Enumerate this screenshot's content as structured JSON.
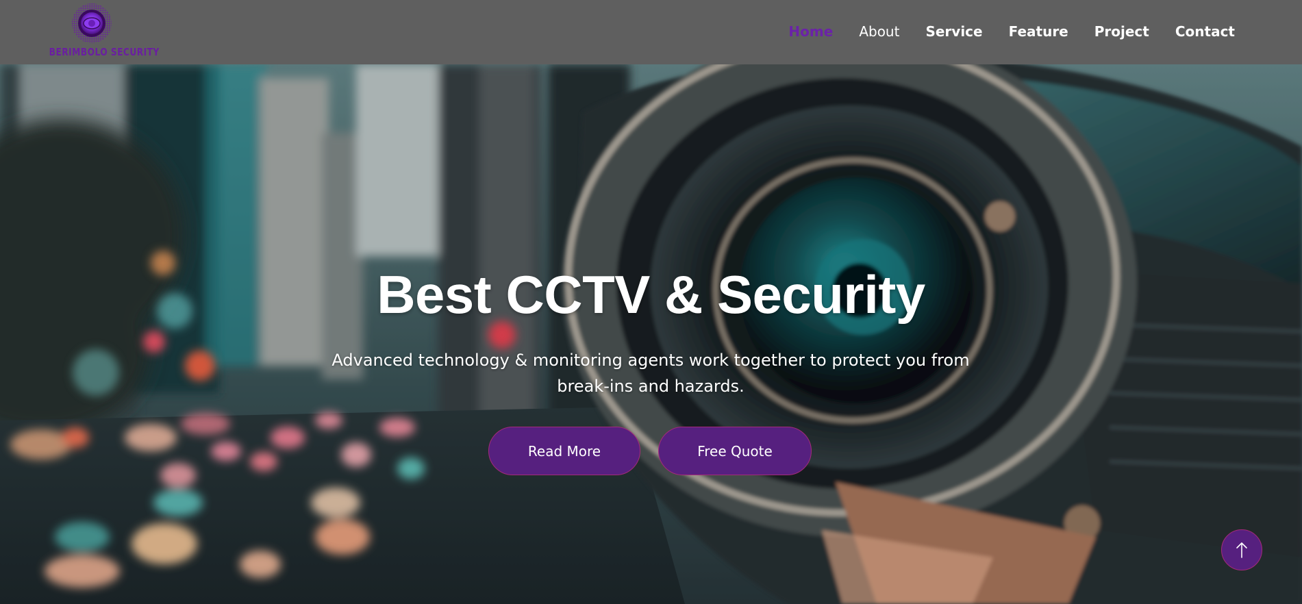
{
  "brand": {
    "name": "BERIMBOLO SECURITY",
    "color": "#6a1fa0",
    "logo_icon": "eye-lens-icon"
  },
  "nav": {
    "items": [
      {
        "label": "Home",
        "active": true
      },
      {
        "label": "About",
        "active": false
      },
      {
        "label": "Service",
        "active": false
      },
      {
        "label": "Feature",
        "active": false
      },
      {
        "label": "Project",
        "active": false
      },
      {
        "label": "Contact",
        "active": false
      }
    ],
    "active_color": "#6b22a8"
  },
  "hero": {
    "title": "Best CCTV & Security",
    "subtitle": "Advanced technology & monitoring agents work together to protect you from break-ins and hazards.",
    "background": "cctv-camera-city-street-photo"
  },
  "buttons": {
    "read_more": "Read More",
    "free_quote": "Free Quote",
    "color": "#56207f",
    "border_color": "#a42a7a"
  },
  "back_to_top": {
    "icon": "arrow-up-icon"
  }
}
